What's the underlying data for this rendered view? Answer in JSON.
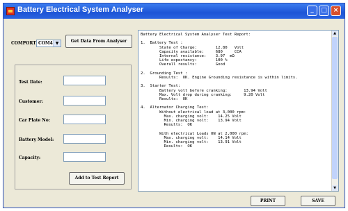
{
  "window": {
    "title": "Battery Electrical System Analyser"
  },
  "controls": {
    "comport_label": "COMPORT:",
    "comport_value": "COM4",
    "get_data_button": "Get Data From Analyser",
    "add_button": "Add to Test Report",
    "print_button": "PRINT",
    "save_button": "SAVE"
  },
  "form": {
    "test_date_label": "Test Date:",
    "customer_label": "Customer:",
    "car_plate_label": "Car Plate No:",
    "battery_model_label": "Battery Model:",
    "capacity_label": "Capacity:",
    "test_date_value": "",
    "customer_value": "",
    "car_plate_value": "",
    "battery_model_value": "",
    "capacity_value": ""
  },
  "report": {
    "text": "Battery Electrical System Analyser Test Report:\n\n1.  Battery Test :\n        State of Charge:        12.80   Volt\n        Capacity available:     680     CCA\n        Internal resistance:    3.97  mΩ\n        Life expectancy:        100 %\n        Overall results:        Good\n\n2.  Grounding Test :\n        Results:  OK. Engine Grounding resistance is within limits.\n\n3.  Starter Test:\n        Battery volt before cranking:       13.94 Volt\n        Max. Volt drop during cranking:     9.20 Volt\n        Results:  OK\n\n4.  Alternator Charging Test:\n        Without electrical load at 3,000 rpm:\n          Max. charging volt:    14.25 Volt\n          Min. charging volt:    13.94 Volt\n          Results:  OK\n\n        With electrical Loads ON at 2,000 rpm:\n          Max. charging volt:    14.14 Volt\n          Min. charging volt:    13.91 Volt\n          Results:  OK"
  }
}
